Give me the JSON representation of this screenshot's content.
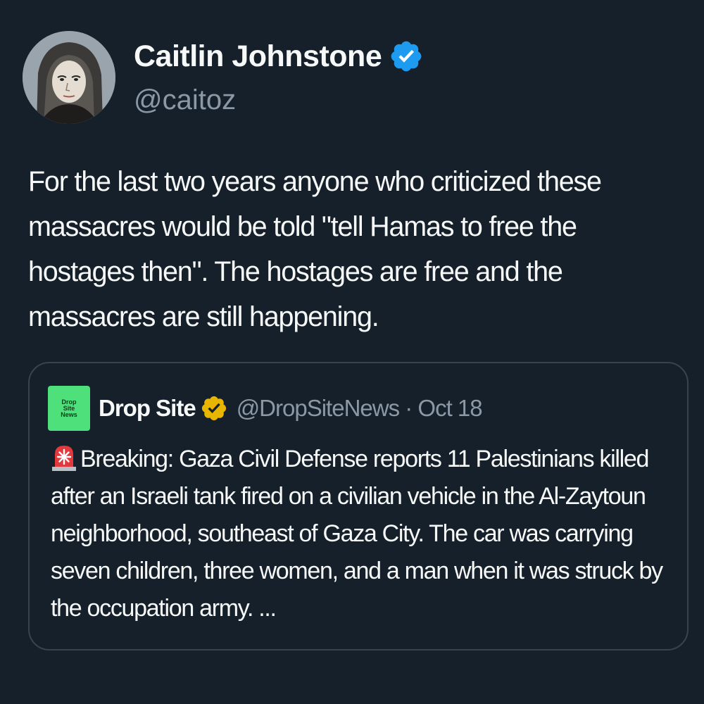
{
  "author": {
    "display_name": "Caitlin Johnstone",
    "handle": "@caitoz",
    "verified": true,
    "verified_icon": "verified-badge-icon",
    "accent_color": "#1d9bf0"
  },
  "tweet": {
    "text": "For the last two years anyone who criticized these massacres would be told \"tell Hamas to free the hostages then\". The hostages are free and the massacres are still happening."
  },
  "quote": {
    "avatar_text": [
      "Drop",
      "Site",
      "News"
    ],
    "display_name": "Drop Site",
    "verified_icon": "gold-verified-badge-icon",
    "handle_and_date": "@DropSiteNews · Oct 18",
    "siren_icon": "police-siren-icon",
    "text": "Breaking: Gaza Civil Defense reports 11 Palestinians killed after an Israeli tank fired on a civilian vehicle in the Al-Zaytoun neighborhood, southeast of Gaza City. The car was carrying seven children, three women, and a man when it was struck by the occupation army. ..."
  },
  "colors": {
    "background": "#15202b",
    "text_primary": "#f7f9f9",
    "text_secondary": "#8b98a5",
    "border": "#38444d",
    "gold_badge": "#e8b500",
    "drop_site_green": "#4ee07a"
  }
}
